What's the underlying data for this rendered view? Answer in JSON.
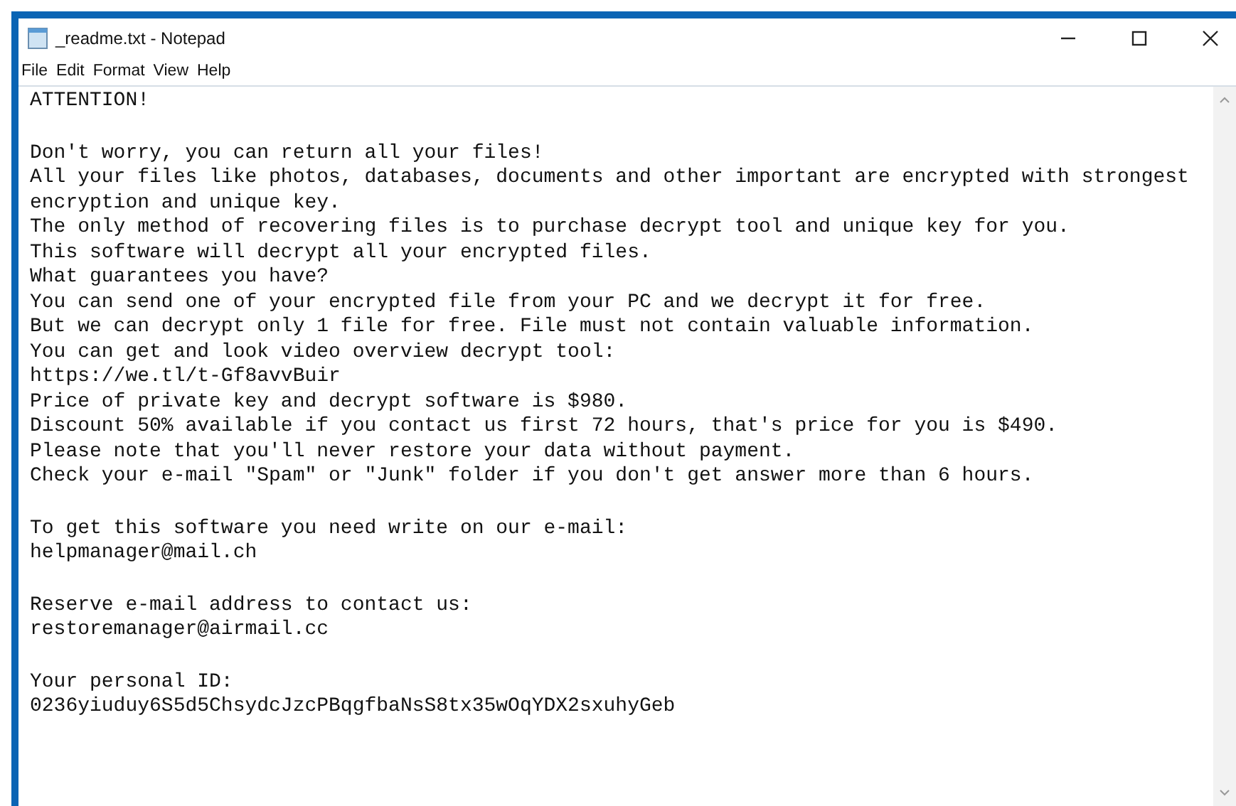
{
  "window": {
    "title": "_readme.txt - Notepad"
  },
  "menu": [
    "File",
    "Edit",
    "Format",
    "View",
    "Help"
  ],
  "document": {
    "blocks": [
      {
        "lines": [
          "ATTENTION!"
        ]
      },
      {
        "lines": [
          "Don't worry, you can return all your files!",
          "All your files like photos, databases, documents and other important are encrypted with strongest",
          "encryption and unique key.",
          "The only method of recovering files is to purchase decrypt tool and unique key for you.",
          "This software will decrypt all your encrypted files.",
          "What guarantees you have?",
          "You can send one of your encrypted file from your PC and we decrypt it for free.",
          "But we can decrypt only 1 file for free. File must not contain valuable information.",
          "You can get and look video overview decrypt tool:",
          "https://we.tl/t-Gf8avvBuir",
          "Price of private key and decrypt software is $980.",
          "Discount 50% available if you contact us first 72 hours, that's price for you is $490.",
          "Please note that you'll never restore your data without payment.",
          "Check your e-mail \"Spam\" or \"Junk\" folder if you don't get answer more than 6 hours."
        ]
      },
      {
        "lines": [
          "To get this software you need write on our e-mail:",
          "helpmanager@mail.ch"
        ]
      },
      {
        "lines": [
          "Reserve e-mail address to contact us:",
          "restoremanager@airmail.cc"
        ]
      },
      {
        "lines": [
          "Your personal ID:",
          "0236yiuduy6S5d5ChsydcJzcPBqgfbaNsS8tx35wOqYDX2sxuhyGeb"
        ]
      }
    ]
  }
}
